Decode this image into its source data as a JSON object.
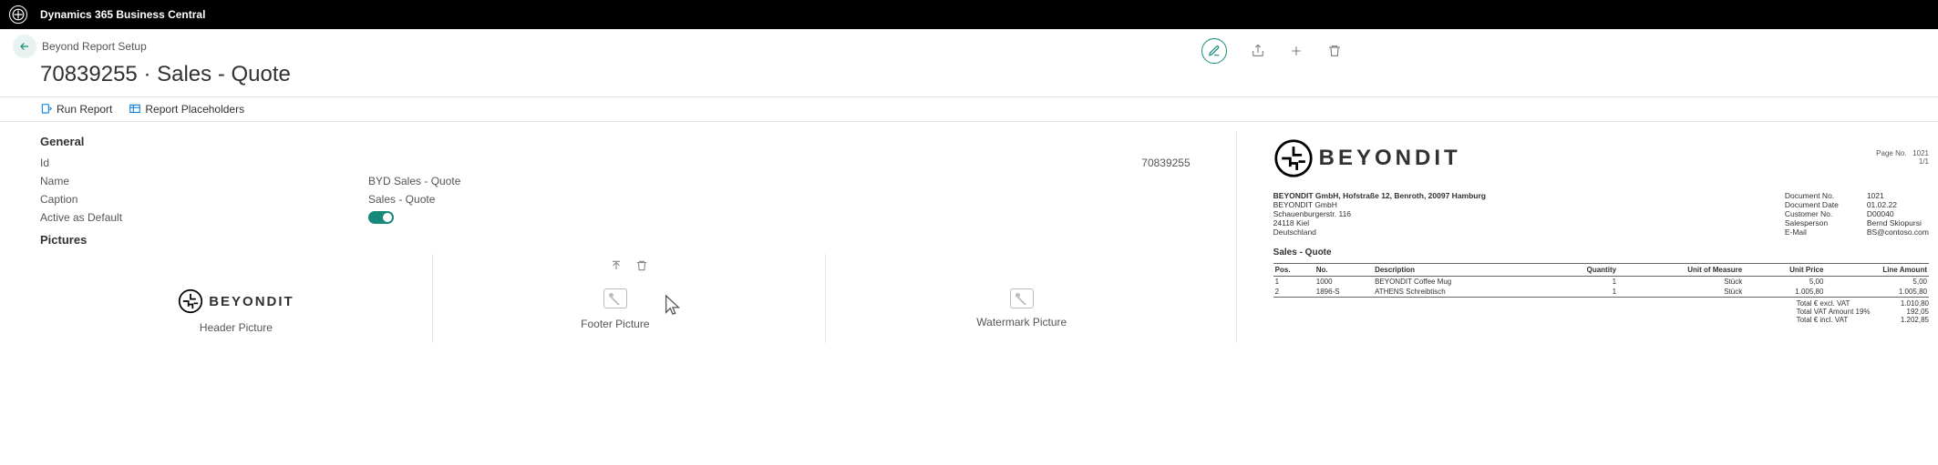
{
  "app_title": "Dynamics 365 Business Central",
  "breadcrumb": "Beyond Report Setup",
  "page_title": "70839255 · Sales - Quote",
  "toolbar": {
    "run_report": "Run Report",
    "placeholders": "Report Placeholders"
  },
  "sections": {
    "general": "General",
    "pictures": "Pictures"
  },
  "fields": {
    "id_label": "Id",
    "id_value": "70839255",
    "name_label": "Name",
    "name_value": "BYD Sales - Quote",
    "caption_label": "Caption",
    "caption_value": "Sales - Quote",
    "active_label": "Active as Default"
  },
  "pictures": {
    "header": "Header Picture",
    "footer": "Footer Picture",
    "watermark": "Watermark Picture",
    "logo_text": "BEYONDIT"
  },
  "preview": {
    "logo_text": "BEYONDIT",
    "page_no_label": "Page No.",
    "page_no": "1021",
    "page_frac": "1/1",
    "company": "BEYONDIT GmbH, Hofstraße 12, Benroth, 20097 Hamburg",
    "addr1": "BEYONDIT GmbH",
    "addr2": "Schauenburgerstr. 116",
    "addr3": "24118 Kiel",
    "addr4": "Deutschland",
    "meta": {
      "docno_l": "Document No.",
      "docno_v": "1021",
      "date_l": "Document Date",
      "date_v": "01.02.22",
      "cust_l": "Customer No.",
      "cust_v": "D00040",
      "sales_l": "Salesperson",
      "sales_v": "Bernd Skiopursi",
      "email_l": "E-Mail",
      "email_v": "BS@contoso.com"
    },
    "doc_title": "Sales - Quote",
    "columns": {
      "pos": "Pos.",
      "no": "No.",
      "desc": "Description",
      "qty": "Quantity",
      "uom": "Unit of Measure",
      "price": "Unit Price",
      "amount": "Line Amount"
    },
    "rows": [
      {
        "pos": "1",
        "no": "1000",
        "desc": "BEYONDIT Coffee Mug",
        "qty": "1",
        "uom": "Stück",
        "price": "5,00",
        "amount": "5,00"
      },
      {
        "pos": "2",
        "no": "1896-S",
        "desc": "ATHENS Schreibtisch",
        "qty": "1",
        "uom": "Stück",
        "price": "1.005,80",
        "amount": "1.005,80"
      }
    ],
    "totals": {
      "excl_l": "Total € excl. VAT",
      "excl_v": "1.010,80",
      "vat_l": "Total VAT Amount 19%",
      "vat_v": "192,05",
      "incl_l": "Total € incl. VAT",
      "incl_v": "1.202,85"
    }
  }
}
